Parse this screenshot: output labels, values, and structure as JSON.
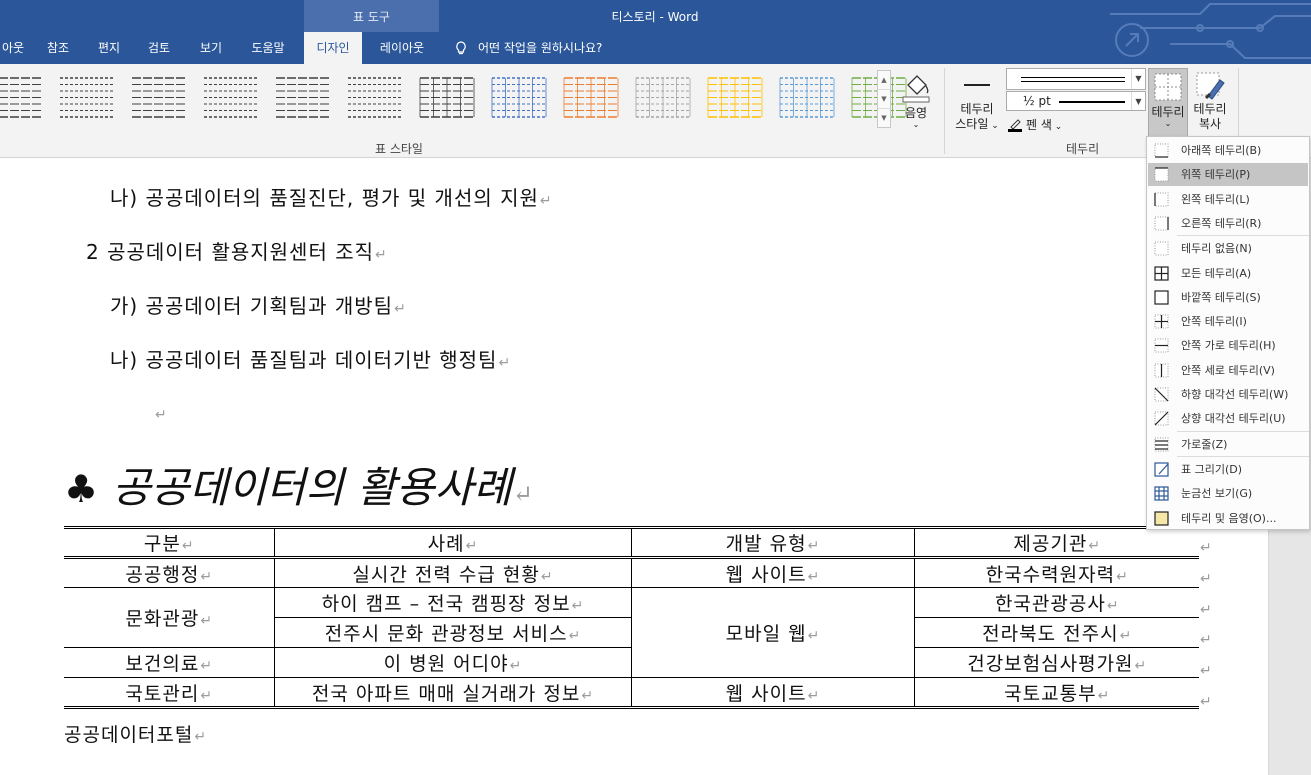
{
  "window": {
    "title": "티스토리  -  Word",
    "context_tab_group": "표 도구"
  },
  "ribbon_tabs": [
    {
      "label": "아웃",
      "active": false
    },
    {
      "label": "참조",
      "active": false
    },
    {
      "label": "편지",
      "active": false
    },
    {
      "label": "검토",
      "active": false
    },
    {
      "label": "보기",
      "active": false
    },
    {
      "label": "도움말",
      "active": false
    },
    {
      "label": "디자인",
      "active": true
    },
    {
      "label": "레이아웃",
      "active": false
    }
  ],
  "tell_me": "어떤 작업을 원하시나요?",
  "ribbon": {
    "table_styles_label": "표 스타일",
    "shading_label": "음영",
    "border_style_label_1": "테두리",
    "border_style_label_2": "스타일",
    "weight": "½ pt",
    "pen_color_label": "펜 색",
    "borders_group_label": "테두리",
    "borders_button_label": "테두리",
    "border_painter_label_1": "테두리",
    "border_painter_label_2": "복사",
    "table_style_colors": [
      "#404040",
      "#404040",
      "#404040",
      "#404040",
      "#404040",
      "#404040",
      "#404040",
      "#4472c4",
      "#ed7d31",
      "#a5a5a5",
      "#ffc000",
      "#5b9bd5",
      "#70ad47"
    ]
  },
  "document": {
    "lines": [
      "나)  공공데이터의 품질진단, 평가 및 개선의 지원",
      "2 공공데이터 활용지원센터 조직",
      "가)  공공데이터 기획팀과 개방팀",
      "나)  공공데이터 품질팀과 데이터기반 행정팀"
    ],
    "heading_symbol": "♣",
    "heading": "공공데이터의 활용사례",
    "paragraph_mark": "↵",
    "table": {
      "headers": [
        "구분",
        "사례",
        "개발 유형",
        "제공기관"
      ],
      "rows": [
        {
          "category": "공공행정",
          "case": "실시간 전력 수급 현황",
          "type": "웹 사이트",
          "provider": "한국수력원자력"
        },
        {
          "category": "문화관광",
          "case": "하이 캠프 – 전국 캠핑장 정보",
          "type": "모바일 웹",
          "provider": "한국관광공사"
        },
        {
          "case": "전주시 문화 관광정보 서비스",
          "provider": "전라북도 전주시"
        },
        {
          "category": "보건의료",
          "case": "이 병원 어디야",
          "provider": "건강보험심사평가원"
        },
        {
          "category": "국토관리",
          "case": "전국 아파트 매매 실거래가 정보",
          "type": "웹 사이트",
          "provider": "국토교통부"
        }
      ]
    },
    "source": "공공데이터포털"
  },
  "borders_menu": {
    "items": [
      {
        "label": "아래쪽 테두리(B)",
        "icon": "bottom-border-icon"
      },
      {
        "label": "위쪽 테두리(P)",
        "icon": "top-border-icon",
        "hover": true
      },
      {
        "label": "왼쪽 테두리(L)",
        "icon": "left-border-icon"
      },
      {
        "label": "오른쪽 테두리(R)",
        "icon": "right-border-icon"
      },
      {
        "label": "테두리 없음(N)",
        "icon": "no-border-icon"
      },
      {
        "label": "모든 테두리(A)",
        "icon": "all-borders-icon"
      },
      {
        "label": "바깥쪽 테두리(S)",
        "icon": "outside-borders-icon"
      },
      {
        "label": "안쪽 테두리(I)",
        "icon": "inside-borders-icon"
      },
      {
        "label": "안쪽 가로 테두리(H)",
        "icon": "inside-horizontal-border-icon"
      },
      {
        "label": "안쪽 세로 테두리(V)",
        "icon": "inside-vertical-border-icon"
      },
      {
        "label": "하향 대각선 테두리(W)",
        "icon": "diagonal-down-border-icon"
      },
      {
        "label": "상향 대각선 테두리(U)",
        "icon": "diagonal-up-border-icon"
      },
      {
        "label": "가로줄(Z)",
        "icon": "horizontal-line-icon"
      },
      {
        "label": "표 그리기(D)",
        "icon": "draw-table-icon"
      },
      {
        "label": "눈금선 보기(G)",
        "icon": "view-gridlines-icon"
      },
      {
        "label": "테두리 및 음영(O)...",
        "icon": "borders-and-shading-icon"
      }
    ]
  },
  "colors": {
    "title_bar": "#2b579a",
    "menu_hover": "#c5c5c5",
    "ribbon_bg": "#f3f3f3"
  }
}
